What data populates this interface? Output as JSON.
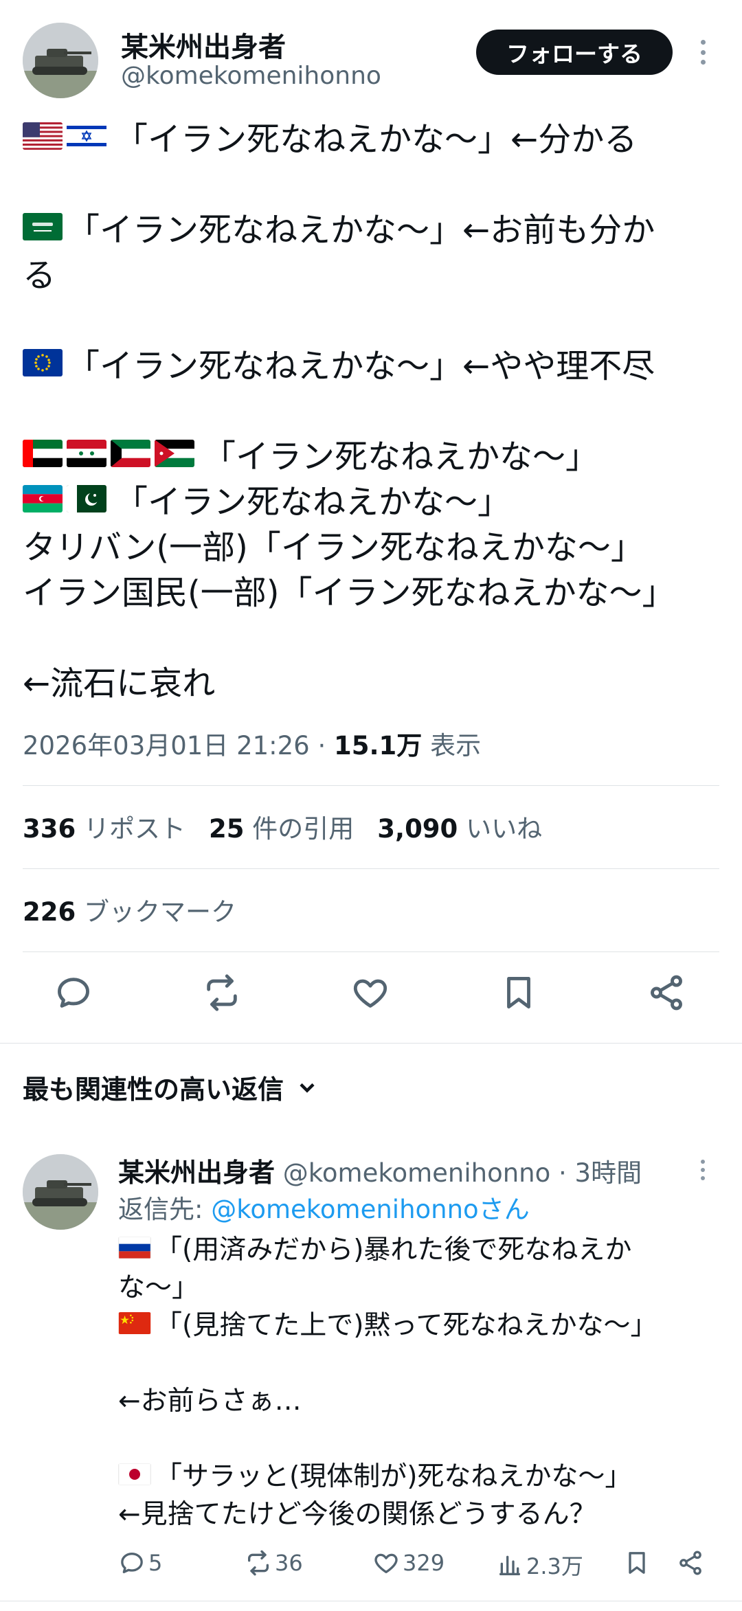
{
  "author": {
    "display_name": "某米州出身者",
    "handle": "@komekomenihonno",
    "follow_label": "フォローする"
  },
  "post": {
    "line1": "「イラン死なねえかな〜」←分かる",
    "line2a": "「イラン死なねえかな〜」←お前も分か",
    "line2b": "る",
    "line3": "「イラン死なねえかな〜」←やや理不尽",
    "line4": "「イラン死なねえかな〜」",
    "line5": "「イラン死なねえかな〜」",
    "line6": "タリバン(一部)「イラン死なねえかな〜」",
    "line7": "イラン国民(一部)「イラン死なねえかな〜」",
    "line8": "←流石に哀れ"
  },
  "meta": {
    "timestamp": "2026年03月01日 21:26",
    "separator": " · ",
    "views": "15.1万",
    "views_label": " 表示"
  },
  "stats": {
    "reposts": "336",
    "reposts_label": "リポスト",
    "quotes": "25",
    "quotes_label": "件の引用",
    "likes": "3,090",
    "likes_label": "いいね",
    "bookmarks": "226",
    "bookmarks_label": "ブックマーク"
  },
  "sort": {
    "label": "最も関連性の高い返信"
  },
  "reply": {
    "display_name": "某米州出身者",
    "handle": "@komekomenihonno",
    "time": " · 3時間",
    "reply_to_prefix": "返信先: ",
    "reply_to_handle": "@komekomenihonnoさん",
    "line1a": "「(用済みだから)暴れた後で死なねえか",
    "line1b": "な〜」",
    "line2": "「(見捨てた上で)黙って死なねえかな〜」",
    "line3": "←お前らさぁ…",
    "line4": "「サラッと(現体制が)死なねえかな〜」",
    "line5": "←見捨てたけど今後の関係どうするん？",
    "replies": "5",
    "reposts": "36",
    "likes": "329",
    "views": "2.3万"
  },
  "icons": {
    "reply": "speech-bubble-icon",
    "repost": "repost-arrows-icon",
    "like": "heart-icon",
    "bookmark": "bookmark-icon",
    "share": "share-icon",
    "views": "bar-chart-icon",
    "chevron": "chevron-down-icon"
  },
  "colors": {
    "text": "#0f1419",
    "muted": "#536471",
    "link": "#1d9bf0",
    "button_bg": "#0f1419"
  }
}
